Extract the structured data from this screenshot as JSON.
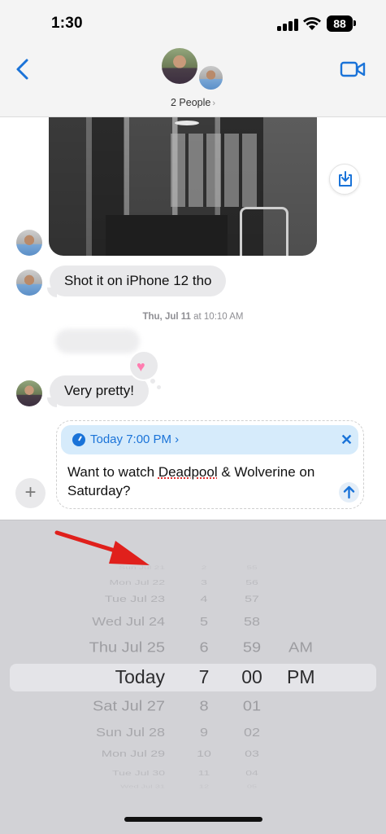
{
  "status_bar": {
    "time": "1:30",
    "battery": "88"
  },
  "header": {
    "group_label": "2 People"
  },
  "messages": [
    {
      "text": "Shot it on iPhone 12 tho"
    },
    {
      "text": "Very pretty!"
    }
  ],
  "timestamp": {
    "day": "Thu, Jul 11",
    "time": "at 10:10 AM"
  },
  "compose": {
    "schedule_label": "Today 7:00 PM",
    "text_before": "Want to watch ",
    "text_misspelled": "Deadpool",
    "text_after": " & Wolverine on Saturday?"
  },
  "picker": {
    "dates": [
      "Sun Jul 21",
      "Mon Jul 22",
      "Tue Jul 23",
      "Wed Jul 24",
      "Thu Jul 25",
      "Today",
      "Sat Jul 27",
      "Sun Jul 28",
      "Mon Jul 29",
      "Tue Jul 30",
      "Wed Jul 31"
    ],
    "hours": [
      "2",
      "3",
      "4",
      "5",
      "6",
      "7",
      "8",
      "9",
      "10",
      "11",
      "12"
    ],
    "minutes": [
      "55",
      "56",
      "57",
      "58",
      "59",
      "00",
      "01",
      "02",
      "03",
      "04",
      "05"
    ],
    "periods": [
      "AM",
      "PM"
    ],
    "selected_index": 5
  },
  "colors": {
    "accent": "#1a73d8",
    "bubble": "#e9e9eb",
    "picker_bg": "#d2d2d6",
    "annotation_arrow": "#e0201c"
  }
}
